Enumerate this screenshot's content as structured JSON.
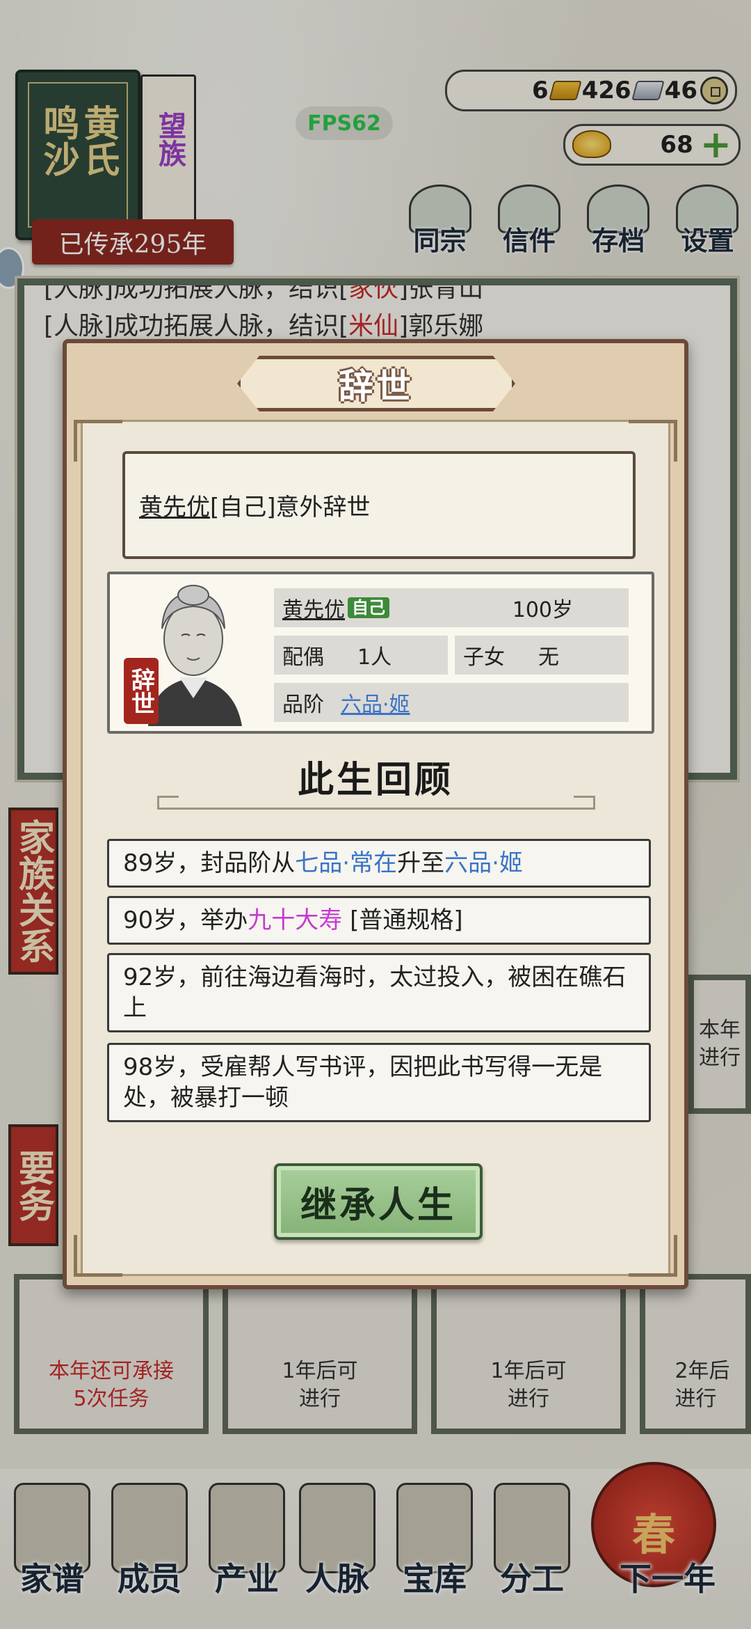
{
  "clan": {
    "name_a": "鸣沙",
    "name_b": "黄氏",
    "tag": "望族",
    "inherit": "已传承295年"
  },
  "fps": "FPS62",
  "resources": {
    "gold": "6",
    "silver": "426",
    "coin": "46",
    "yuanbao": "68"
  },
  "top_buttons": [
    "同宗",
    "信件",
    "存档",
    "设置"
  ],
  "background_log": {
    "line1_prefix": "[人脉]成功拓展人脉，结识[",
    "line1_name": "家伙",
    "line1_suffix": "]张青山",
    "line2_prefix": "[人脉]成功拓展人脉，结识[",
    "line2_name": "米仙",
    "line2_suffix": "]郭乐娜"
  },
  "side_tabs": {
    "family": "家族关系",
    "tasks": "要务"
  },
  "bg_cards": {
    "task_a": "本年还可承接\n5次任务",
    "task_b": "1年后可\n进行",
    "task_c": "1年后可\n进行",
    "task_d": "2年后\n进行",
    "land": "本年\n进行"
  },
  "bottom_nav": [
    "家谱",
    "成员",
    "产业",
    "人脉",
    "宝库",
    "分工"
  ],
  "next_year": "下一年",
  "lantern_char": "春",
  "modal": {
    "title": "辞世",
    "message_name": "黄先优",
    "message_rest": "[自己]意外辞世",
    "person": {
      "name": "黄先优",
      "self_badge": "自己",
      "age": "100岁",
      "stamp": "辞世",
      "spouse_label": "配偶",
      "spouse_value": "1人",
      "children_label": "子女",
      "children_value": "无",
      "rank_label": "品阶",
      "rank_value": "六品·姬"
    },
    "review_title": "此生回顾",
    "events": [
      {
        "a": "89岁，封品阶从",
        "b": "七品·常在",
        "c": "升至",
        "d": "六品·姬"
      },
      {
        "a": "90岁，举办",
        "b": "九十大寿",
        "c": " [普通规格]"
      },
      {
        "a": "92岁，前往海边看海时，太过投入，被困在礁石上"
      },
      {
        "a": "98岁，受雇帮人写书评，因把此书写得一无是处，被暴打一顿"
      }
    ],
    "inherit_button": "继承人生"
  },
  "colors": {
    "accent_green": "#3d8a3a",
    "link_blue": "#3a73c7",
    "highlight_pink": "#c43ad2",
    "seal_red": "#a3261e"
  }
}
